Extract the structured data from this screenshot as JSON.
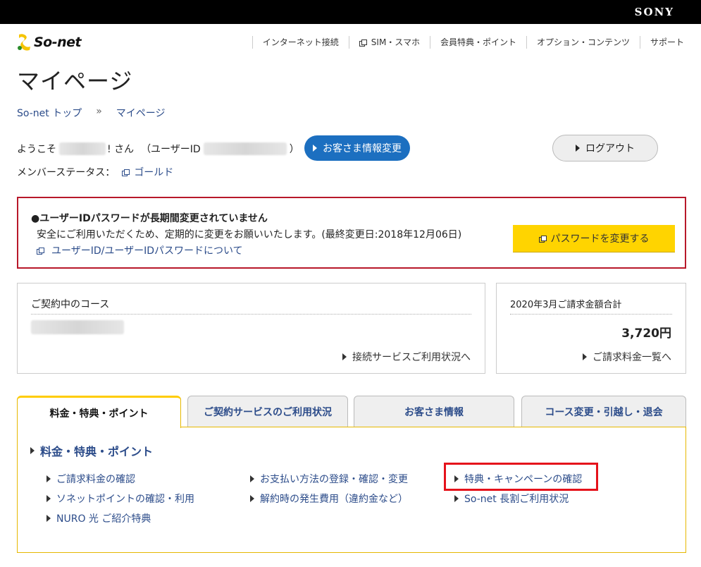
{
  "brand": {
    "corporate": "SONY",
    "logo_text": "So-net"
  },
  "global_nav": [
    {
      "label": "インターネット接続",
      "external": false
    },
    {
      "label": "SIM・スマホ",
      "external": true
    },
    {
      "label": "会員特典・ポイント",
      "external": false
    },
    {
      "label": "オプション・コンテンツ",
      "external": false
    },
    {
      "label": "サポート",
      "external": false
    }
  ],
  "page_title": "マイページ",
  "breadcrumb": {
    "home": "So-net トップ",
    "separator": "»",
    "current": "マイページ"
  },
  "welcome": {
    "prefix": "ようこそ",
    "suffix": "! さん",
    "userid_open": "（ユーザーID",
    "userid_close": "）",
    "edit_button": "お客さま情報変更",
    "logout_button": "ログアウト"
  },
  "member_status": {
    "label": "メンバーステータス：",
    "value": "ゴールド"
  },
  "alert": {
    "heading": "●ユーザーIDパスワードが長期間変更されていません",
    "body": "安全にご利用いただくため、定期的に変更をお願いいたします。(最終変更日:2018年12月06日)",
    "link": "ユーザーID/ユーザーIDパスワードについて",
    "button": "パスワードを変更する"
  },
  "course": {
    "label": "ご契約中のコース",
    "link": "接続サービスご利用状況へ"
  },
  "billing": {
    "label": "2020年3月ご請求金額合計",
    "amount": "3,720円",
    "link": "ご請求料金一覧へ"
  },
  "tabs": [
    {
      "label": "料金・特典・ポイント",
      "active": true
    },
    {
      "label": "ご契約サービスのご利用状況",
      "active": false
    },
    {
      "label": "お客さま情報",
      "active": false
    },
    {
      "label": "コース変更・引越し・退会",
      "active": false
    }
  ],
  "panel": {
    "title": "料金・特典・ポイント",
    "links": [
      "ご請求料金の確認",
      "ソネットポイントの確認・利用",
      "NURO 光 ご紹介特典",
      "お支払い方法の登録・確認・変更",
      "解約時の発生費用（違約金など）",
      "特典・キャンペーンの確認",
      "So-net 長割ご利用状況"
    ]
  },
  "colors": {
    "accent_blue": "#1c6fc0",
    "link_blue": "#2c4c8a",
    "alert_red": "#b8182a",
    "yellow": "#ffd400",
    "highlight_red": "#e5121b"
  }
}
